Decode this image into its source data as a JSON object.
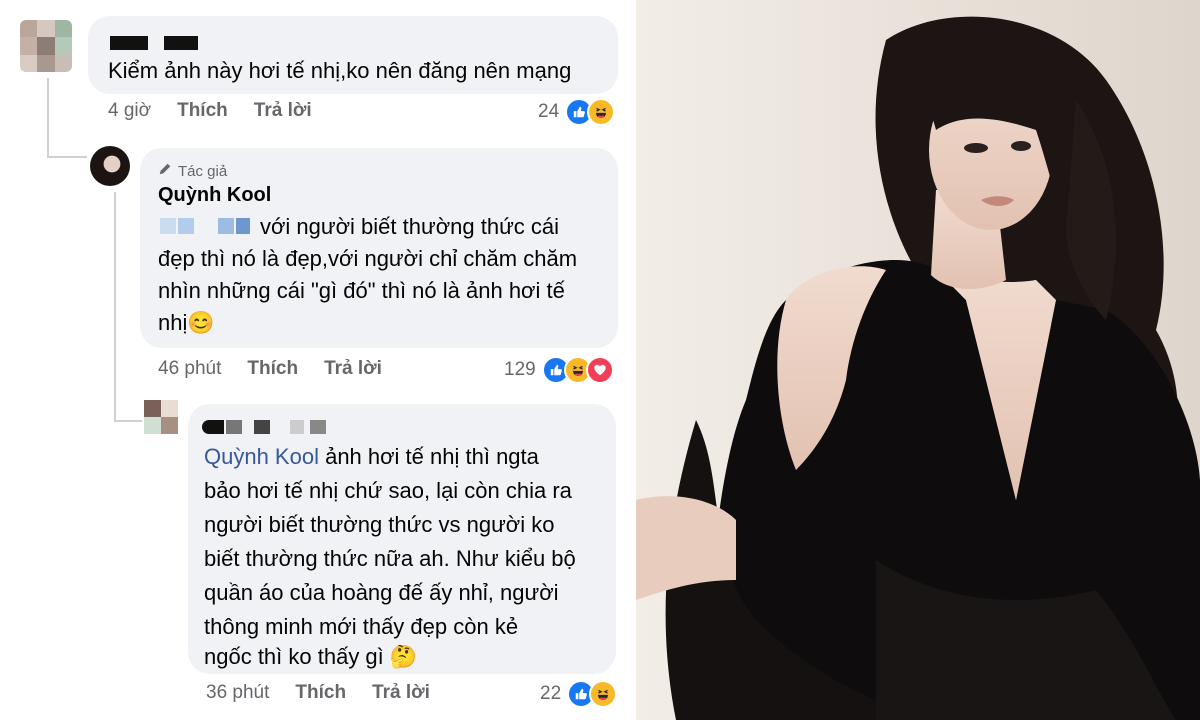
{
  "comment1": {
    "text": "Kiểm ảnh này hơi tế nhị,ko nên đăng nên mạng",
    "time": "4 giờ",
    "like_label": "Thích",
    "reply_label": "Trả lời",
    "reaction_count": "24",
    "reactions": [
      "like-icon",
      "haha-icon"
    ]
  },
  "comment2": {
    "author_badge": "Tác giả",
    "author": "Quỳnh Kool",
    "text_lines": [
      "với người biết thường thức cái",
      "đẹp thì nó là đẹp,với người chỉ chăm chăm",
      "nhìn những cái \"gì đó\" thì nó là ảnh hơi tế",
      "nhị😊"
    ],
    "time": "46 phút",
    "like_label": "Thích",
    "reply_label": "Trả lời",
    "reaction_count": "129",
    "reactions": [
      "like-icon",
      "haha-icon",
      "love-icon"
    ]
  },
  "comment3": {
    "mention": "Quỳnh Kool",
    "text_first": " ảnh hơi tế nhị thì ngta",
    "text_lines": [
      "bảo hơi tế nhị chứ sao, lại còn chia ra",
      "người biết thường thức vs người ko",
      "biết thường thức nữa ah. Như kiểu bộ",
      "quần áo của hoàng đế ấy nhỉ, người",
      "thông minh mới thấy đẹp còn kẻ",
      "ngốc thì ko thấy gì 🤔"
    ],
    "time": "36 phút",
    "like_label": "Thích",
    "reply_label": "Trả lời",
    "reaction_count": "22",
    "reactions": [
      "like-icon",
      "haha-icon"
    ]
  },
  "colors": {
    "bubble": "#f0f2f5",
    "meta_text": "#65676b",
    "like_blue": "#1877f2",
    "haha_yellow": "#f7b928",
    "love_red": "#f33e58",
    "mention_blue": "#385898"
  }
}
